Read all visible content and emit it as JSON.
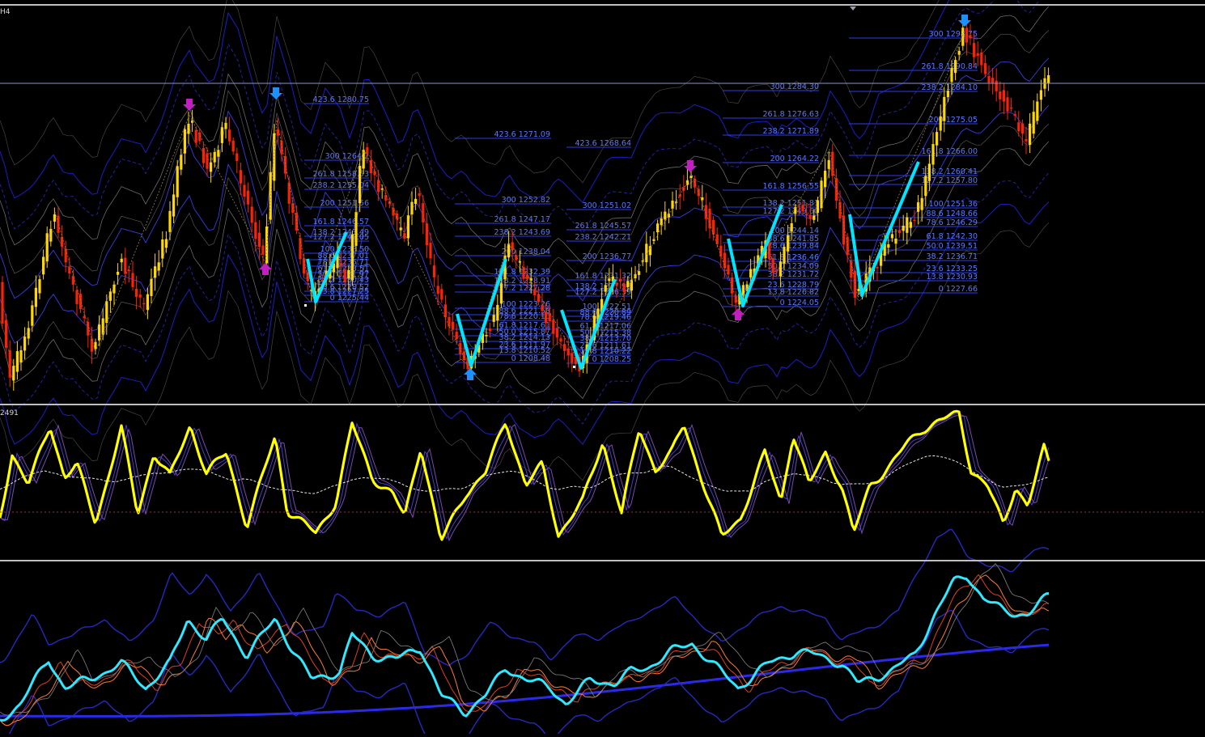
{
  "window": {
    "symbol_tag": "H4",
    "oscillator_tag": "2491"
  },
  "colors": {
    "background": "#000000",
    "bull_candle": "#ffd700",
    "bear_candle": "#ff2200",
    "fib_line": "#2c3ee6",
    "fib_text": "#5a78ff",
    "zigzag": "#00e5ff",
    "oscillator": "#ffff00",
    "momentum": "#30e8ff",
    "arrow_down": "#1e8fff",
    "arrow_purple": "#c020c0"
  },
  "fib_sets": [
    {
      "levels": [
        {
          "text": "423.6 1280.75"
        },
        {
          "text": "300 1264.2"
        },
        {
          "text": "261.8 1258.53"
        },
        {
          "text": "238.2 1255.04"
        },
        {
          "text": "200 1251.56"
        },
        {
          "text": "161.8 1246.57"
        },
        {
          "text": "138.2 1243.49"
        },
        {
          "text": "127.2 1242.05"
        },
        {
          "text": "100 1238.50"
        },
        {
          "text": "88.6 1237.01"
        },
        {
          "text": "78.6 1235.71"
        },
        {
          "text": "61.8 1233.51"
        },
        {
          "text": "50.0 1231.97"
        },
        {
          "text": "38.2 1230.43"
        },
        {
          "text": "23.6 1228.52"
        },
        {
          "text": "13.8 1227.25"
        },
        {
          "text": "0 1225.44"
        }
      ]
    },
    {
      "levels": [
        {
          "text": "423.6 1271.09"
        },
        {
          "text": "300 1252.82"
        },
        {
          "text": "261.8 1247.17"
        },
        {
          "text": "238.2 1243.69"
        },
        {
          "text": "200 1238.04"
        },
        {
          "text": "161.8 1232.39"
        },
        {
          "text": "138.2 1228.91"
        },
        {
          "text": "127.2 1227.28"
        },
        {
          "text": "100 1223.26"
        },
        {
          "text": "88.6 1221.58"
        },
        {
          "text": "78.6 1220.10"
        },
        {
          "text": "61.8 1217.61"
        },
        {
          "text": "50.0 1215.87"
        },
        {
          "text": "38.2 1214.13"
        },
        {
          "text": "23.6 1211.97"
        },
        {
          "text": "13.8 1210.52"
        },
        {
          "text": "0 1208.48"
        }
      ]
    },
    {
      "levels": [
        {
          "text": "423.6 1268.64"
        },
        {
          "text": "300 1251.02"
        },
        {
          "text": "261.8 1245.57"
        },
        {
          "text": "238.2 1242.21"
        },
        {
          "text": "200 1236.77"
        },
        {
          "text": "161.8 1231.32"
        },
        {
          "text": "138.2 1227.96"
        },
        {
          "text": "127.2 1226.39"
        },
        {
          "text": "100 1222.51"
        },
        {
          "text": "88.6 1220.89"
        },
        {
          "text": "78.6 1219.46"
        },
        {
          "text": "61.8 1217.06"
        },
        {
          "text": "50.0 1215.38"
        },
        {
          "text": "38.2 1213.70"
        },
        {
          "text": "23.6 1211.61"
        },
        {
          "text": "13.8 1210.22"
        },
        {
          "text": "0 1208.25"
        }
      ]
    },
    {
      "levels": [
        {
          "text": "300 1284.30"
        },
        {
          "text": "261.8 1276.63"
        },
        {
          "text": "238.2 1271.89"
        },
        {
          "text": "200 1264.22"
        },
        {
          "text": "161.8 1256.55"
        },
        {
          "text": "138.2 1251.81"
        },
        {
          "text": "127.2 1249.60"
        },
        {
          "text": "100 1244.14"
        },
        {
          "text": "88.6 1241.85"
        },
        {
          "text": "78.6 1239.84"
        },
        {
          "text": "61.8 1236.46"
        },
        {
          "text": "50.0 1234.09"
        },
        {
          "text": "38.2 1231.72"
        },
        {
          "text": "23.6 1228.79"
        },
        {
          "text": "13.8 1226.82"
        },
        {
          "text": "0 1224.05"
        }
      ]
    },
    {
      "levels": [
        {
          "text": "300 1298.75"
        },
        {
          "text": "261.8 1290.84"
        },
        {
          "text": "238.2 1284.10"
        },
        {
          "text": "200 1275.05"
        },
        {
          "text": "161.8 1266.00"
        },
        {
          "text": "138.2 1260.41"
        },
        {
          "text": "127.2 1257.80"
        },
        {
          "text": "100 1251.36"
        },
        {
          "text": "88.6 1248.66"
        },
        {
          "text": "78.6 1246.29"
        },
        {
          "text": "61.8 1242.30"
        },
        {
          "text": "50.0 1239.51"
        },
        {
          "text": "38.2 1236.71"
        },
        {
          "text": "23.6 1233.25"
        },
        {
          "text": "13.8 1230.93"
        },
        {
          "text": "0 1227.66"
        }
      ]
    }
  ]
}
